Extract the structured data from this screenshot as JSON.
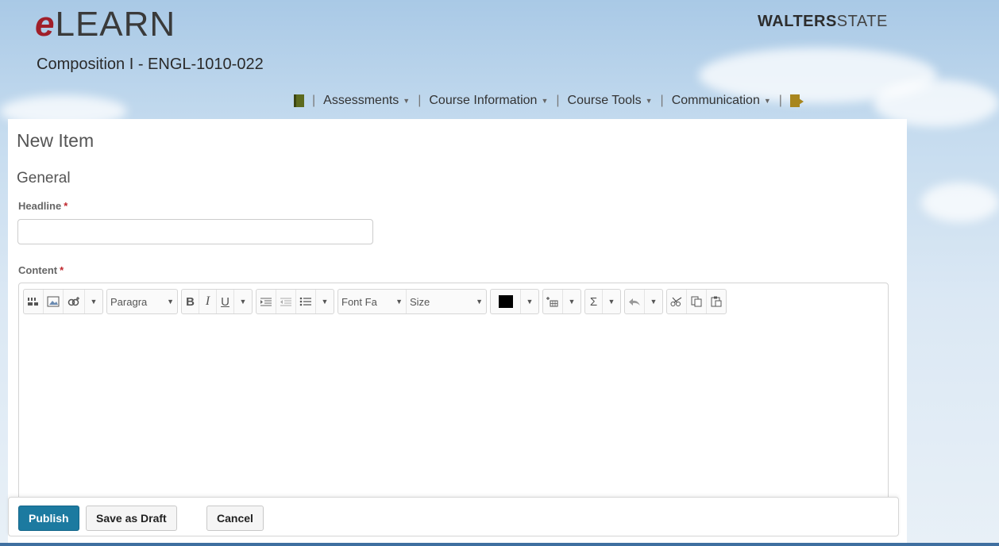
{
  "header": {
    "brand_e": "e",
    "brand_rest": "LEARN",
    "course_title": "Composition I - ENGL-1010-022",
    "school_bold": "WALTERS",
    "school_thin": "STATE"
  },
  "nav": {
    "items": [
      {
        "label": "Assessments"
      },
      {
        "label": "Course Information"
      },
      {
        "label": "Course Tools"
      },
      {
        "label": "Communication"
      }
    ]
  },
  "page": {
    "title": "New Item",
    "section": "General",
    "headline_label": "Headline",
    "headline_value": "",
    "content_label": "Content",
    "required_mark": "*"
  },
  "toolbar": {
    "paragraph": "Paragra",
    "font_family": "Font Fa",
    "size": "Size",
    "bold": "B",
    "italic": "I",
    "underline": "U",
    "sigma": "Σ",
    "text_color": "#000000"
  },
  "actions": {
    "publish": "Publish",
    "save_draft": "Save as Draft",
    "cancel": "Cancel"
  },
  "colors": {
    "brand_red": "#a01f2a",
    "primary_button": "#1c7aa0"
  }
}
